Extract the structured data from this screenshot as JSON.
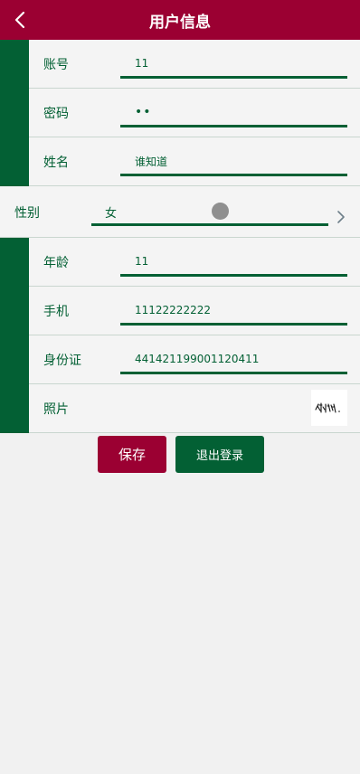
{
  "header": {
    "title": "用户信息",
    "back_icon": "chevron-left-icon"
  },
  "form": {
    "account": {
      "label": "账号",
      "value": "11"
    },
    "password": {
      "label": "密码",
      "value": "••"
    },
    "name": {
      "label": "姓名",
      "value": "谁知道"
    },
    "gender": {
      "label": "性别",
      "value": "女",
      "arrow_icon": "chevron-right-icon"
    },
    "age": {
      "label": "年龄",
      "value": "11"
    },
    "phone": {
      "label": "手机",
      "value": "11122222222"
    },
    "id_card": {
      "label": "身份证",
      "value": "441421199001120411"
    },
    "photo": {
      "label": "照片"
    }
  },
  "actions": {
    "save_label": "保存",
    "logout_label": "退出登录"
  },
  "colors": {
    "brand_red": "#9b0032",
    "brand_green": "#036034",
    "background": "#f1f1f1"
  }
}
